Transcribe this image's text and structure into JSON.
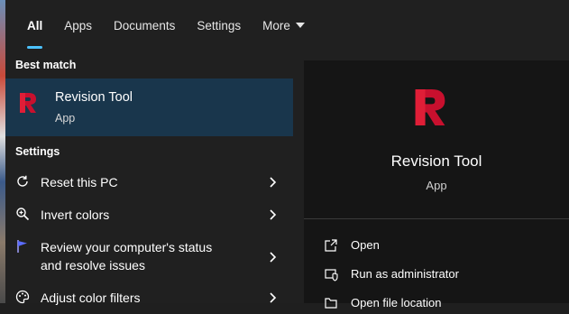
{
  "tabs": [
    {
      "label": "All",
      "active": true
    },
    {
      "label": "Apps",
      "active": false
    },
    {
      "label": "Documents",
      "active": false
    },
    {
      "label": "Settings",
      "active": false
    },
    {
      "label": "More",
      "active": false
    }
  ],
  "results": {
    "best_match_heading": "Best match",
    "best_match": {
      "name": "Revision Tool",
      "type": "App"
    },
    "settings_heading": "Settings",
    "settings_items": [
      {
        "label": "Reset this PC",
        "icon": "sync-icon"
      },
      {
        "label": "Invert colors",
        "icon": "magnifier-icon"
      },
      {
        "label": "Review your computer's status",
        "label2": "and resolve issues",
        "icon": "flag-icon"
      },
      {
        "label": "Adjust color filters",
        "icon": "palette-icon"
      }
    ]
  },
  "preview": {
    "name": "Revision Tool",
    "type": "App",
    "actions": [
      {
        "label": "Open",
        "icon": "open-icon"
      },
      {
        "label": "Run as administrator",
        "icon": "shield-icon"
      },
      {
        "label": "Open file location",
        "icon": "folder-icon"
      }
    ]
  },
  "colors": {
    "accent": "#4cc2ff",
    "selected_bg": "#19364c",
    "brand_red": "#c8102e"
  }
}
